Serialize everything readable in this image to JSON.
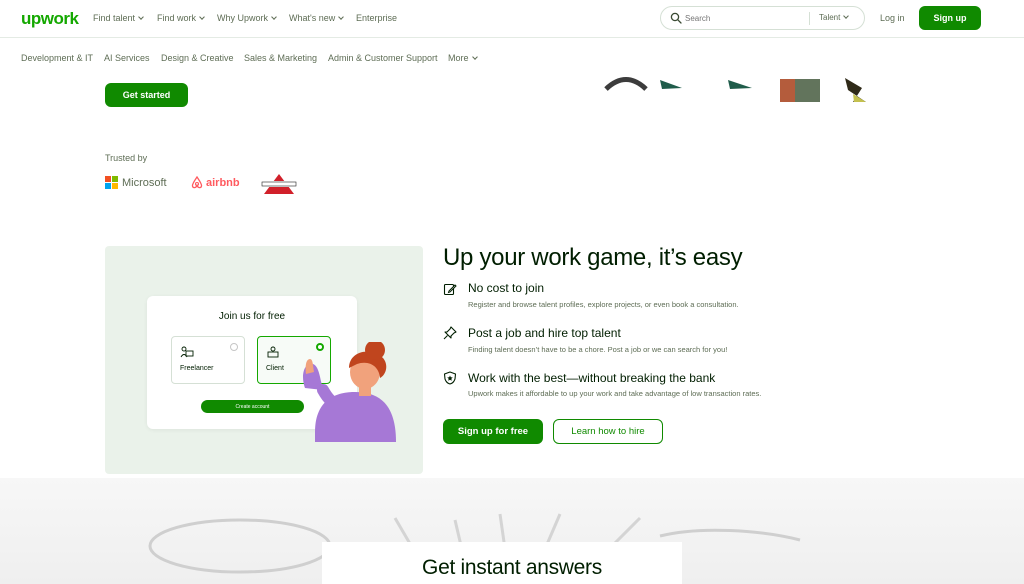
{
  "brand": {
    "logo": "upwork",
    "accent": "#14a800",
    "button_green": "#108a00"
  },
  "nav": {
    "items": [
      {
        "label": "Find talent",
        "dropdown": true
      },
      {
        "label": "Find work",
        "dropdown": true
      },
      {
        "label": "Why Upwork",
        "dropdown": true
      },
      {
        "label": "What's new",
        "dropdown": true
      },
      {
        "label": "Enterprise",
        "dropdown": false
      }
    ],
    "search_placeholder": "Search",
    "search_type": "Talent",
    "login": "Log in",
    "signup": "Sign up"
  },
  "categories": [
    "Development & IT",
    "AI Services",
    "Design & Creative",
    "Sales & Marketing",
    "Admin & Customer Support",
    "More"
  ],
  "hero": {
    "cta": "Get started"
  },
  "trusted": {
    "label": "Trusted by",
    "logos": [
      {
        "name": "microsoft-logo",
        "text": "Microsoft"
      },
      {
        "name": "airbnb-logo",
        "text": "airbnb"
      },
      {
        "name": "bissell-logo",
        "text": "BISSELL"
      }
    ]
  },
  "illustration": {
    "card_title": "Join us for free",
    "roles": [
      "Freelancer",
      "Client"
    ],
    "selected_role": "Client",
    "create_button": "Create account"
  },
  "features": {
    "headline": "Up your work game, it’s easy",
    "items": [
      {
        "icon": "edit-icon",
        "title": "No cost to join",
        "desc": "Register and browse talent profiles, explore projects, or even book a consultation."
      },
      {
        "icon": "pin-icon",
        "title": "Post a job and hire top talent",
        "desc": "Finding talent doesn’t have to be a chore. Post a job or we can search for you!"
      },
      {
        "icon": "shield-icon",
        "title": "Work with the best—without breaking the bank",
        "desc": "Upwork makes it affordable to up your work and take advantage of low transaction rates."
      }
    ],
    "primary_cta": "Sign up for free",
    "secondary_cta": "Learn how to hire"
  },
  "bottom": {
    "title": "Get instant answers"
  }
}
